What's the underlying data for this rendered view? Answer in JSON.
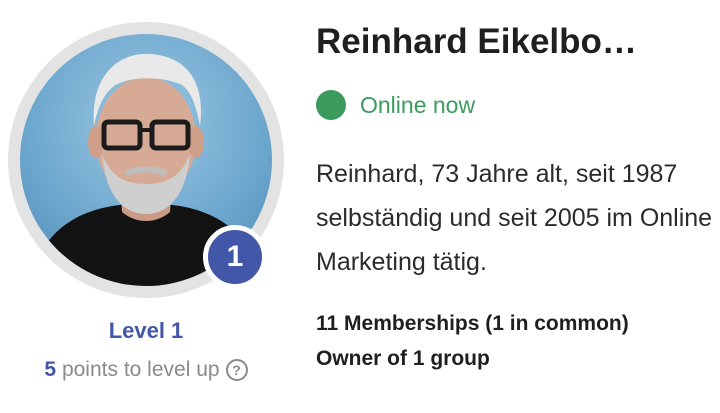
{
  "profile": {
    "name": "Reinhard Eikelbo…",
    "status": "Online now",
    "bio": "Reinhard, 73 Jahre alt, seit 1987 selbständig und seit 2005 im Online Marketing tätig.",
    "memberships": "11 Memberships (1 in common)",
    "owner": "Owner of 1 group"
  },
  "level": {
    "badge": "1",
    "label": "Level 1",
    "points_value": "5",
    "points_text": "points to level up",
    "help_icon": "?"
  },
  "colors": {
    "accent": "#4357a8",
    "online": "#3b9a5c",
    "muted": "#8a8a8a"
  },
  "icons": {
    "status": "online-dot-icon",
    "help": "question-circle-icon"
  }
}
